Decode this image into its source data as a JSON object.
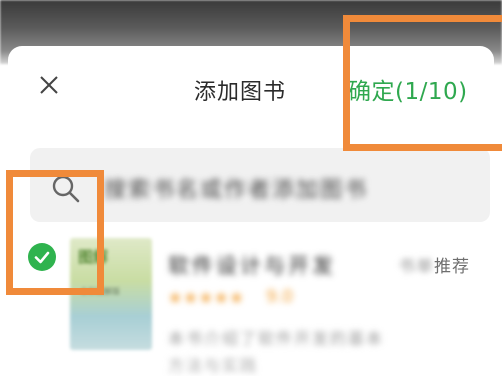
{
  "dialog": {
    "title": "添加图书",
    "confirm_label": "确定(1/10)",
    "close_icon": "close-icon"
  },
  "search": {
    "placeholder": "搜索书名或作者添加图书",
    "icon": "search-icon"
  },
  "book": {
    "selected": true,
    "cover_title": "图解",
    "cover_subtitle": "全彩图解版",
    "title": "软件设计与开发",
    "stars": "★★★★★",
    "rating": "9.0",
    "recommend_source": "书单",
    "recommend_label": "推荐",
    "desc_line1": "本书介绍了软件开发的基本",
    "desc_line2": "方法与实践"
  },
  "colors": {
    "accent_green": "#2fa84f",
    "highlight_orange": "#f08a3a",
    "star_orange": "#f2a23a"
  }
}
